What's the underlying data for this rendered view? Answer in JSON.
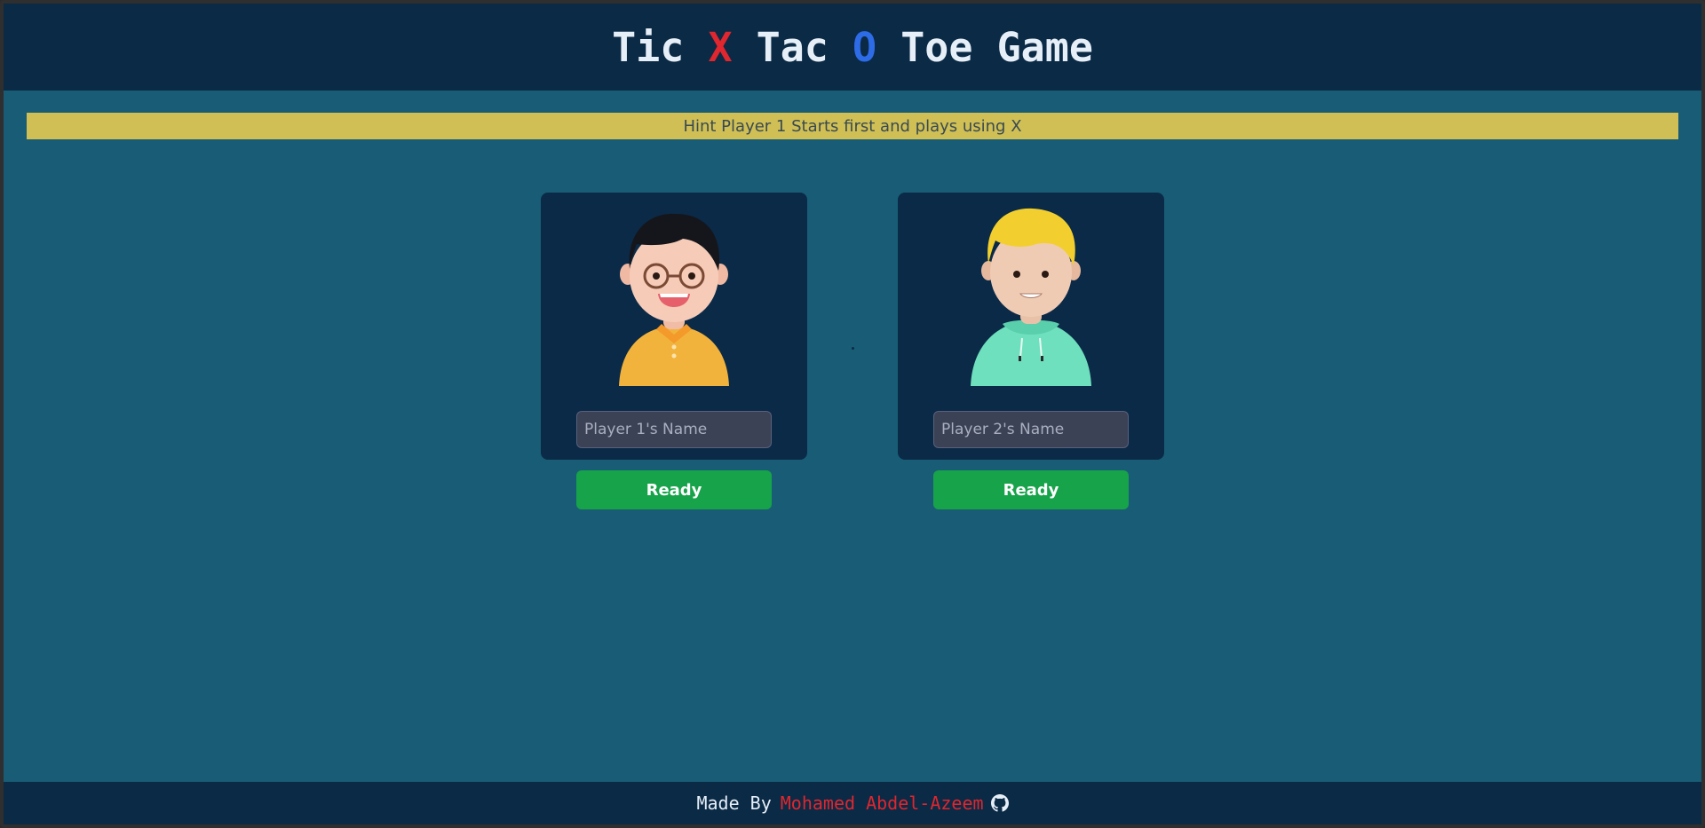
{
  "header": {
    "title_parts": [
      "Tic",
      "X",
      "Tac",
      "O",
      "Toe",
      "Game"
    ]
  },
  "hint": {
    "text": "Hint Player 1 Starts first and plays using X"
  },
  "players": [
    {
      "name_placeholder": "Player 1's Name",
      "name_value": "",
      "ready_label": "Ready",
      "avatar": "boy-glasses-avatar"
    },
    {
      "name_placeholder": "Player 2's Name",
      "name_value": "",
      "ready_label": "Ready",
      "avatar": "blonde-boy-hoodie-avatar"
    }
  ],
  "footer": {
    "prefix": "Made By",
    "author": "Mohamed Abdel-Azeem",
    "icon": "github-icon"
  },
  "colors": {
    "background": "#185d75",
    "header": "#0a2a46",
    "hint_bar": "#cfbf55",
    "x_color": "#e0262e",
    "o_color": "#2e6be6",
    "ready_button": "#17a34a"
  }
}
